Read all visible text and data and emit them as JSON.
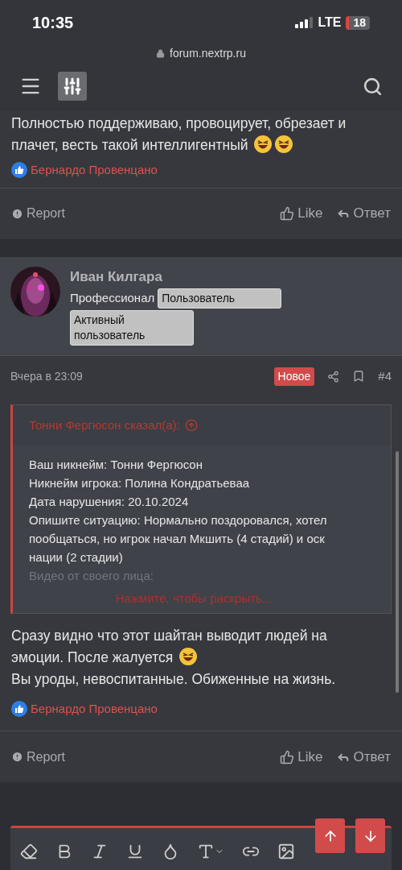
{
  "status_bar": {
    "time": "10:35",
    "network": "LTE",
    "battery": "18"
  },
  "address_bar": {
    "url": "forum.nextrp.ru"
  },
  "posts": [
    {
      "kind": "continued",
      "body": [
        "Полностью поддерживаю, провоцирует, обрезает и плачет, весть такой интеллигентный"
      ],
      "emojis": [
        {
          "kind": "laughing"
        },
        {
          "kind": "laughing"
        }
      ],
      "reactions": "Бернардо Провенцано",
      "actions": {
        "report": "Report",
        "like": "Like",
        "reply": "Ответ"
      }
    },
    {
      "kind": "full",
      "author": {
        "name": "Иван Килгара",
        "title": "Профессионал",
        "badges": [
          "Пользователь",
          "Активный пользователь"
        ]
      },
      "date": "Вчера в 23:09",
      "new_label": "Новое",
      "number": "#4",
      "quote": {
        "header": "Тонни Фергюсон сказал(а):",
        "lines": [
          "Ваш никнейм: Тонни Фергюсон",
          "Никнейм игрока: Полина Кондратьеваа",
          "Дата нарушения: 20.10.2024",
          "Опишите ситуацию: Нормально поздоровался, хотел пообщаться, но игрок начал Мкшить (4 стадий) и оск нации (2 стадии)",
          "Видео от своего лица:"
        ],
        "expanded": false,
        "expand_link": "Нажмите, чтобы раскрыть..."
      },
      "body": [
        "Сразу видно что этот шайтан выводит людей на эмоции. После жалуется",
        "Вы уроды, невоспитанные. Обиженные на жизнь."
      ],
      "emojis": [
        {
          "kind": "laughing"
        }
      ],
      "reactions": "Бернардо Провенцано",
      "actions": {
        "report": "Report",
        "like": "Like",
        "reply": "Ответ"
      }
    }
  ]
}
